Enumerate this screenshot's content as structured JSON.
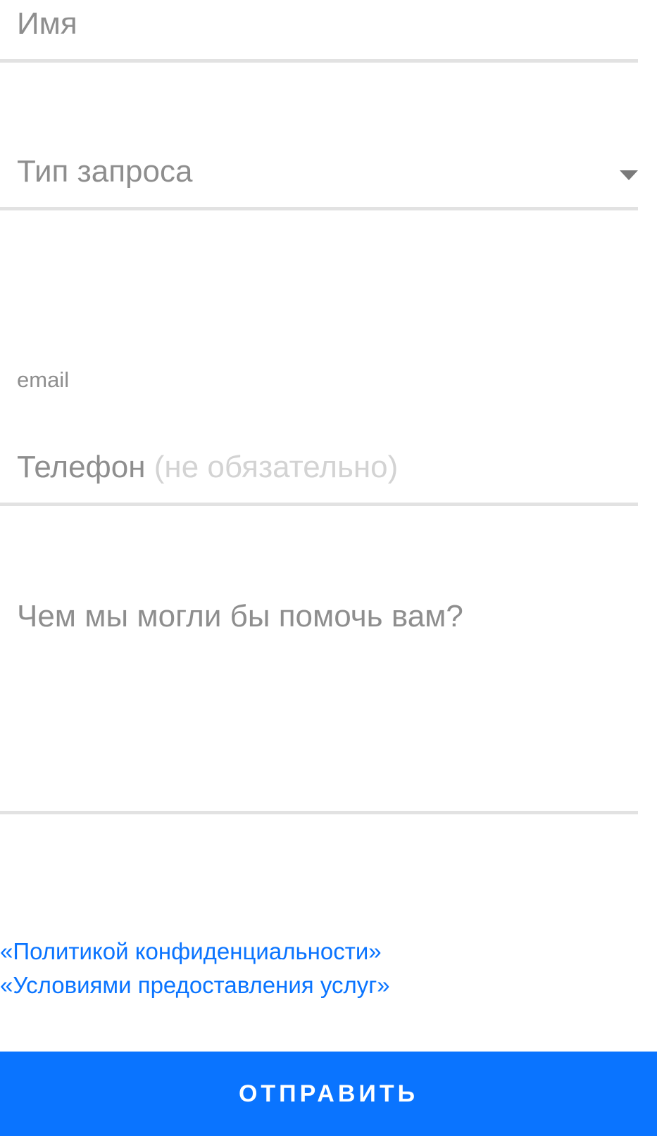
{
  "form": {
    "name_placeholder": "Имя",
    "request_type_placeholder": "Тип запроса",
    "email_label": "email",
    "phone_placeholder": "Телефон",
    "phone_hint": "(не обязательно)",
    "message_placeholder": "Чем мы могли бы помочь вам?"
  },
  "links": {
    "privacy_policy": "«Политикой конфиденциальности»",
    "terms_of_service": "«Условиями предоставления услуг»"
  },
  "submit_label": "ОТПРАВИТЬ",
  "colors": {
    "accent": "#0a74ff",
    "placeholder_text": "#8e8e8e",
    "hint_text": "#d3d3d3",
    "divider": "#e2e2e2"
  }
}
